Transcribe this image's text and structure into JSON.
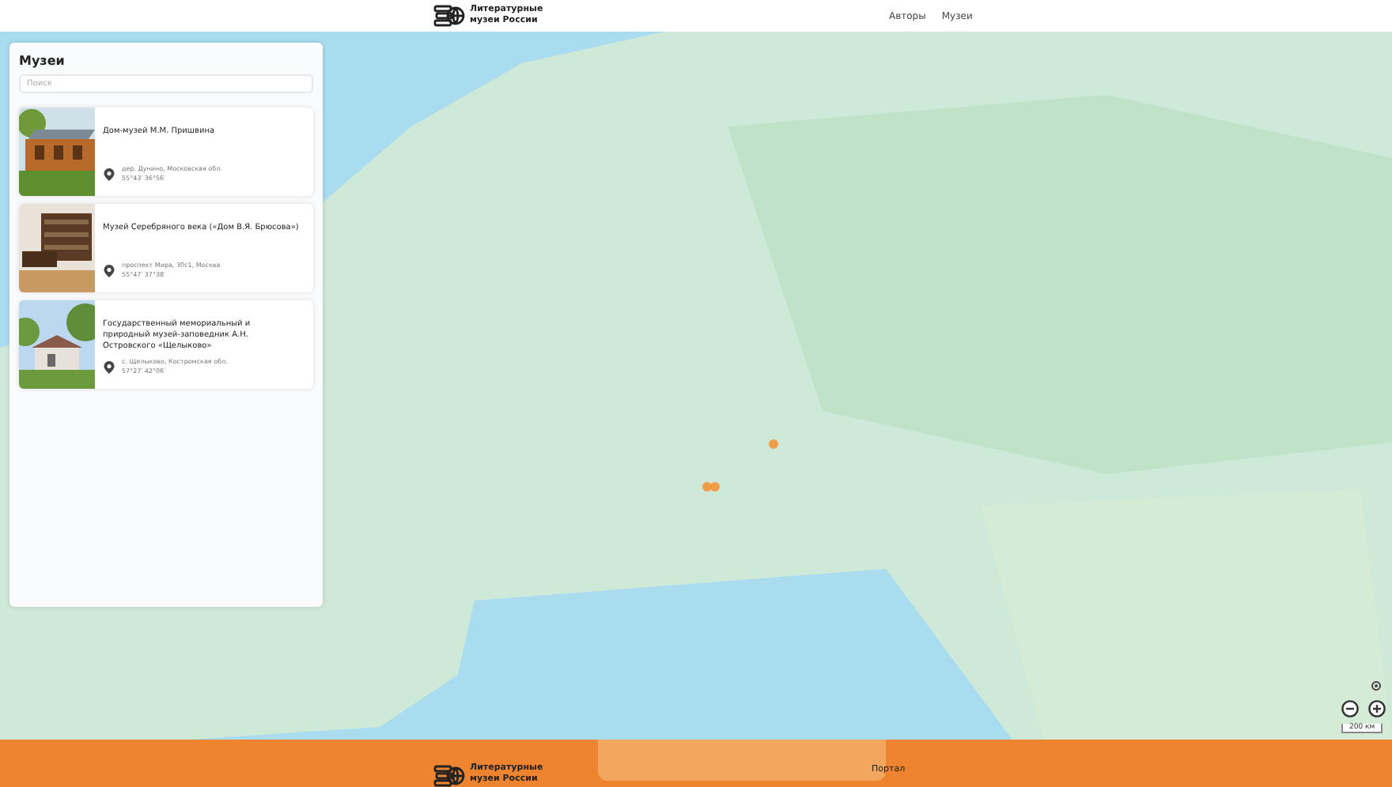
{
  "header": {
    "logo": [
      "Литературные",
      "музеи России"
    ],
    "nav": [
      {
        "label": "Авторы"
      },
      {
        "label": "Музеи"
      }
    ]
  },
  "sidebar": {
    "title": "Музеи",
    "search": {
      "placeholder": "Поиск"
    },
    "museums": [
      {
        "name": "Дом-музей М.М. Пришвина",
        "address": "дер. Дунино, Московская обл.",
        "coords": "55°43′ 36°56′"
      },
      {
        "name": "Музей Серебряного века («Дом В.Я. Брюсова»)",
        "address": "проспект Мира, 30с1, Москва",
        "coords": "55°47′ 37°38′"
      },
      {
        "name": "Государственный мемориальный и природный музей-заповедник А.Н. Островского «Щелыково»",
        "address": "с. Щелыково, Костромская обл.",
        "coords": "57°27′ 42°06′"
      }
    ]
  },
  "map": {
    "scale": "200 км"
  },
  "footer": {
    "logo": [
      "Литературные",
      "музеи России"
    ],
    "links": [
      "Портал"
    ]
  }
}
